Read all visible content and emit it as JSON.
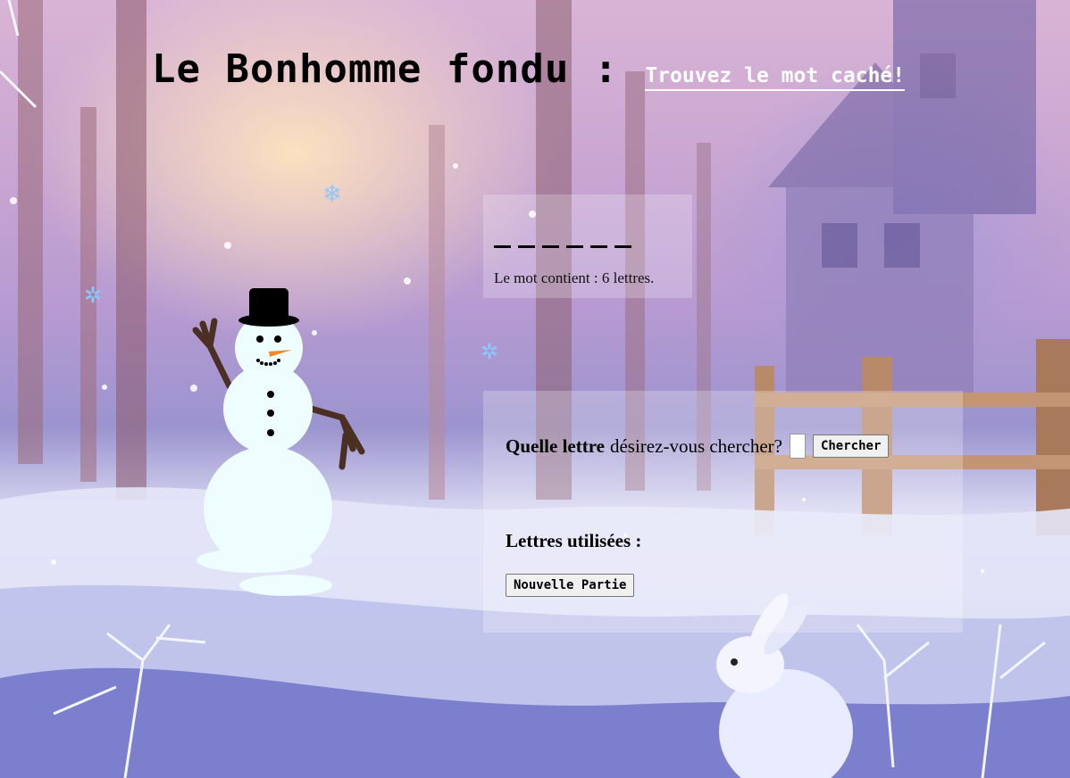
{
  "header": {
    "title": "Le Bonhomme fondu :",
    "subtitle": "Trouvez le mot caché!"
  },
  "word": {
    "letters_count": 6,
    "count_text": "Le mot contient : 6 lettres."
  },
  "form": {
    "question_bold": "Quelle lettre",
    "question_rest": "désirez-vous chercher?",
    "letter_value": "",
    "search_label": "Chercher"
  },
  "used": {
    "label": "Lettres utilisées :",
    "letters": ""
  },
  "new_game_label": "Nouvelle Partie",
  "colors": {
    "snowman_body": "#eefeff",
    "hat": "#000000",
    "arms": "#4a2f22",
    "nose": "#f08a2a",
    "snowflake": "#8cc8ff"
  }
}
